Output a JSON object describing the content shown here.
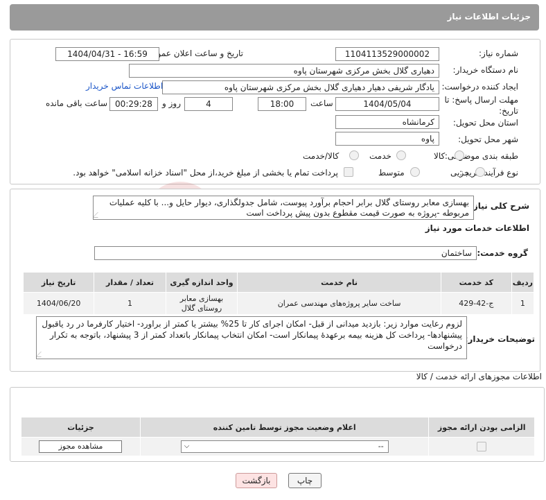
{
  "header": {
    "title": "جزئیات اطلاعات نیاز"
  },
  "form": {
    "need_number": {
      "label": "شماره نیاز:",
      "value": "1104113529000002"
    },
    "announce_date": {
      "label": "تاریخ و ساعت اعلان عمومی:",
      "value": "1404/04/31 - 16:59"
    },
    "buyer_org": {
      "label": "نام دستگاه خریدار:",
      "value": "دهیاری گلال بخش مرکزی شهرستان پاوه"
    },
    "creator": {
      "label": "ایجاد کننده درخواست:",
      "value": "یادگار شریفی دهیار دهیاری گلال بخش مرکزی شهرستان پاوه",
      "contact_link": "اطلاعات تماس خریدار"
    },
    "deadline": {
      "label": "مهلت ارسال پاسخ: تا تاریخ:",
      "date": "1404/05/04",
      "time_label": "ساعت",
      "time": "18:00",
      "days": "4",
      "days_label": "روز و",
      "remaining": "00:29:28",
      "remaining_label": "ساعت باقی مانده"
    },
    "province": {
      "label": "استان محل تحویل:",
      "value": "کرمانشاه"
    },
    "city": {
      "label": "شهر محل تحویل:",
      "value": "پاوه"
    },
    "category": {
      "label": "طبقه بندی موضوعی:",
      "options": [
        "کالا",
        "خدمت",
        "کالا/خدمت"
      ]
    },
    "process_type": {
      "label": "نوع فرآیند خرید :",
      "options": [
        "جزیی",
        "متوسط"
      ],
      "payment_note": "پرداخت تمام یا بخشی از مبلغ خرید،از محل \"اسناد خزانه اسلامی\" خواهد بود."
    }
  },
  "summary": {
    "label": "شرح کلی نیاز:",
    "text": "بهسازی معابر روستای گلال برابر احجام برآورد پیوست، شامل جدولگذاری، دیوار حایل و... با کلیه عملیات مربوطه -پروژه به صورت قیمت مقطوع بدون پیش پرداخت است"
  },
  "services": {
    "section_title": "اطلاعات خدمات مورد نیاز",
    "group_label": "گروه خدمت:",
    "group_value": "ساختمان",
    "columns": [
      "ردیف",
      "کد خدمت",
      "نام خدمت",
      "واحد اندازه گیری",
      "تعداد / مقدار",
      "تاریخ نیاز"
    ],
    "rows": [
      {
        "row": "1",
        "code": "ج-42-429",
        "name": "ساخت سایر پروژه‌های مهندسی عمران",
        "unit": "بهسازی معابر روستای گلال",
        "qty": "1",
        "date": "1404/06/20"
      }
    ]
  },
  "buyer_notes": {
    "label": "توضیحات خریدار:",
    "text": "لزوم رعایت موارد زیر: بازدید میدانی از قبل- امکان اجرای کار تا 25% بیشتر یا کمتر از براورد- اختیار کارفرما در رد یاقبول پیشنهادها- پرداخت کل هزینه بیمه برعهدهٔ پیمانکار است- امکان انتخاب پیمانکار باتعداد کمتر از 3 پیشنهاد، باتوجه به تکرار درخواست"
  },
  "licenses": {
    "section_title": "اطلاعات مجوزهای ارائه خدمت / کالا",
    "columns": [
      "الزامی بودن ارائه مجوز",
      "اعلام وضعیت مجوز توسط تامین کننده",
      "جزئیات"
    ],
    "select_value": "--",
    "view_button": "مشاهده مجوز"
  },
  "footer": {
    "print_label": "چاپ",
    "back_label": "بازگشت"
  },
  "colors": {
    "header_bg": "#9a9a9a",
    "link": "#1a55c8",
    "back_bg": "#fde3e3"
  }
}
